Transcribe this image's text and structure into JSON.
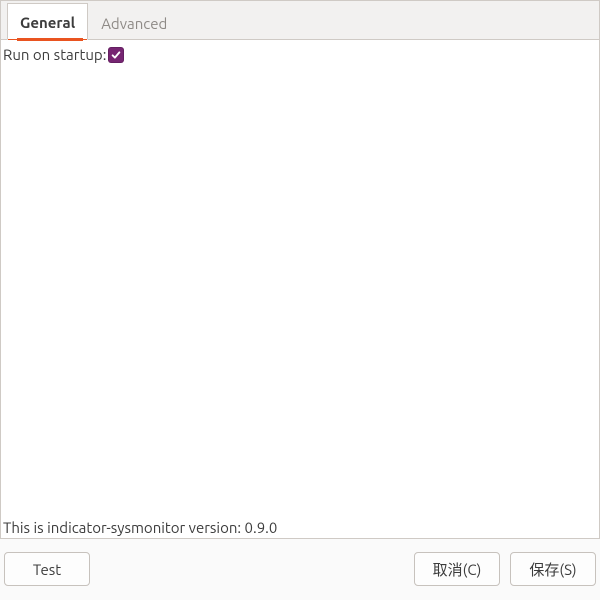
{
  "tabs": {
    "general": "General",
    "advanced": "Advanced",
    "active": "general"
  },
  "general": {
    "run_on_startup_label": "Run on startup:",
    "run_on_startup_checked": true
  },
  "version_line": "This is indicator-sysmonitor version: 0.9.0",
  "buttons": {
    "test": "Test",
    "cancel": "取消(C)",
    "save": "保存(S)"
  }
}
